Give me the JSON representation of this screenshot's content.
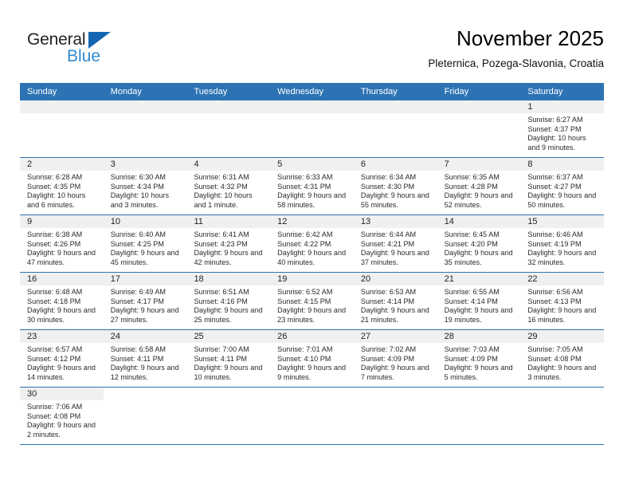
{
  "brand": {
    "name_dark": "General",
    "name_blue": "Blue",
    "accent_color": "#2d73b4",
    "logo_blue": "#2e8bd0"
  },
  "header": {
    "title": "November 2025",
    "location": "Pleternica, Pozega-Slavonia, Croatia"
  },
  "calendar": {
    "weekdays": [
      "Sunday",
      "Monday",
      "Tuesday",
      "Wednesday",
      "Thursday",
      "Friday",
      "Saturday"
    ],
    "header_bg": "#2d73b4",
    "header_text": "#ffffff",
    "daynum_bg": "#f0f0f0",
    "weeks": [
      [
        {
          "day": "",
          "empty": true
        },
        {
          "day": "",
          "empty": true
        },
        {
          "day": "",
          "empty": true
        },
        {
          "day": "",
          "empty": true
        },
        {
          "day": "",
          "empty": true
        },
        {
          "day": "",
          "empty": true
        },
        {
          "day": "1",
          "sunrise": "Sunrise: 6:27 AM",
          "sunset": "Sunset: 4:37 PM",
          "daylight": "Daylight: 10 hours and 9 minutes."
        }
      ],
      [
        {
          "day": "2",
          "sunrise": "Sunrise: 6:28 AM",
          "sunset": "Sunset: 4:35 PM",
          "daylight": "Daylight: 10 hours and 6 minutes."
        },
        {
          "day": "3",
          "sunrise": "Sunrise: 6:30 AM",
          "sunset": "Sunset: 4:34 PM",
          "daylight": "Daylight: 10 hours and 3 minutes."
        },
        {
          "day": "4",
          "sunrise": "Sunrise: 6:31 AM",
          "sunset": "Sunset: 4:32 PM",
          "daylight": "Daylight: 10 hours and 1 minute."
        },
        {
          "day": "5",
          "sunrise": "Sunrise: 6:33 AM",
          "sunset": "Sunset: 4:31 PM",
          "daylight": "Daylight: 9 hours and 58 minutes."
        },
        {
          "day": "6",
          "sunrise": "Sunrise: 6:34 AM",
          "sunset": "Sunset: 4:30 PM",
          "daylight": "Daylight: 9 hours and 55 minutes."
        },
        {
          "day": "7",
          "sunrise": "Sunrise: 6:35 AM",
          "sunset": "Sunset: 4:28 PM",
          "daylight": "Daylight: 9 hours and 52 minutes."
        },
        {
          "day": "8",
          "sunrise": "Sunrise: 6:37 AM",
          "sunset": "Sunset: 4:27 PM",
          "daylight": "Daylight: 9 hours and 50 minutes."
        }
      ],
      [
        {
          "day": "9",
          "sunrise": "Sunrise: 6:38 AM",
          "sunset": "Sunset: 4:26 PM",
          "daylight": "Daylight: 9 hours and 47 minutes."
        },
        {
          "day": "10",
          "sunrise": "Sunrise: 6:40 AM",
          "sunset": "Sunset: 4:25 PM",
          "daylight": "Daylight: 9 hours and 45 minutes."
        },
        {
          "day": "11",
          "sunrise": "Sunrise: 6:41 AM",
          "sunset": "Sunset: 4:23 PM",
          "daylight": "Daylight: 9 hours and 42 minutes."
        },
        {
          "day": "12",
          "sunrise": "Sunrise: 6:42 AM",
          "sunset": "Sunset: 4:22 PM",
          "daylight": "Daylight: 9 hours and 40 minutes."
        },
        {
          "day": "13",
          "sunrise": "Sunrise: 6:44 AM",
          "sunset": "Sunset: 4:21 PM",
          "daylight": "Daylight: 9 hours and 37 minutes."
        },
        {
          "day": "14",
          "sunrise": "Sunrise: 6:45 AM",
          "sunset": "Sunset: 4:20 PM",
          "daylight": "Daylight: 9 hours and 35 minutes."
        },
        {
          "day": "15",
          "sunrise": "Sunrise: 6:46 AM",
          "sunset": "Sunset: 4:19 PM",
          "daylight": "Daylight: 9 hours and 32 minutes."
        }
      ],
      [
        {
          "day": "16",
          "sunrise": "Sunrise: 6:48 AM",
          "sunset": "Sunset: 4:18 PM",
          "daylight": "Daylight: 9 hours and 30 minutes."
        },
        {
          "day": "17",
          "sunrise": "Sunrise: 6:49 AM",
          "sunset": "Sunset: 4:17 PM",
          "daylight": "Daylight: 9 hours and 27 minutes."
        },
        {
          "day": "18",
          "sunrise": "Sunrise: 6:51 AM",
          "sunset": "Sunset: 4:16 PM",
          "daylight": "Daylight: 9 hours and 25 minutes."
        },
        {
          "day": "19",
          "sunrise": "Sunrise: 6:52 AM",
          "sunset": "Sunset: 4:15 PM",
          "daylight": "Daylight: 9 hours and 23 minutes."
        },
        {
          "day": "20",
          "sunrise": "Sunrise: 6:53 AM",
          "sunset": "Sunset: 4:14 PM",
          "daylight": "Daylight: 9 hours and 21 minutes."
        },
        {
          "day": "21",
          "sunrise": "Sunrise: 6:55 AM",
          "sunset": "Sunset: 4:14 PM",
          "daylight": "Daylight: 9 hours and 19 minutes."
        },
        {
          "day": "22",
          "sunrise": "Sunrise: 6:56 AM",
          "sunset": "Sunset: 4:13 PM",
          "daylight": "Daylight: 9 hours and 16 minutes."
        }
      ],
      [
        {
          "day": "23",
          "sunrise": "Sunrise: 6:57 AM",
          "sunset": "Sunset: 4:12 PM",
          "daylight": "Daylight: 9 hours and 14 minutes."
        },
        {
          "day": "24",
          "sunrise": "Sunrise: 6:58 AM",
          "sunset": "Sunset: 4:11 PM",
          "daylight": "Daylight: 9 hours and 12 minutes."
        },
        {
          "day": "25",
          "sunrise": "Sunrise: 7:00 AM",
          "sunset": "Sunset: 4:11 PM",
          "daylight": "Daylight: 9 hours and 10 minutes."
        },
        {
          "day": "26",
          "sunrise": "Sunrise: 7:01 AM",
          "sunset": "Sunset: 4:10 PM",
          "daylight": "Daylight: 9 hours and 9 minutes."
        },
        {
          "day": "27",
          "sunrise": "Sunrise: 7:02 AM",
          "sunset": "Sunset: 4:09 PM",
          "daylight": "Daylight: 9 hours and 7 minutes."
        },
        {
          "day": "28",
          "sunrise": "Sunrise: 7:03 AM",
          "sunset": "Sunset: 4:09 PM",
          "daylight": "Daylight: 9 hours and 5 minutes."
        },
        {
          "day": "29",
          "sunrise": "Sunrise: 7:05 AM",
          "sunset": "Sunset: 4:08 PM",
          "daylight": "Daylight: 9 hours and 3 minutes."
        }
      ],
      [
        {
          "day": "30",
          "sunrise": "Sunrise: 7:06 AM",
          "sunset": "Sunset: 4:08 PM",
          "daylight": "Daylight: 9 hours and 2 minutes."
        },
        {
          "day": "",
          "empty": true,
          "blank": true
        },
        {
          "day": "",
          "empty": true,
          "blank": true
        },
        {
          "day": "",
          "empty": true,
          "blank": true
        },
        {
          "day": "",
          "empty": true,
          "blank": true
        },
        {
          "day": "",
          "empty": true,
          "blank": true
        },
        {
          "day": "",
          "empty": true,
          "blank": true
        }
      ]
    ]
  }
}
